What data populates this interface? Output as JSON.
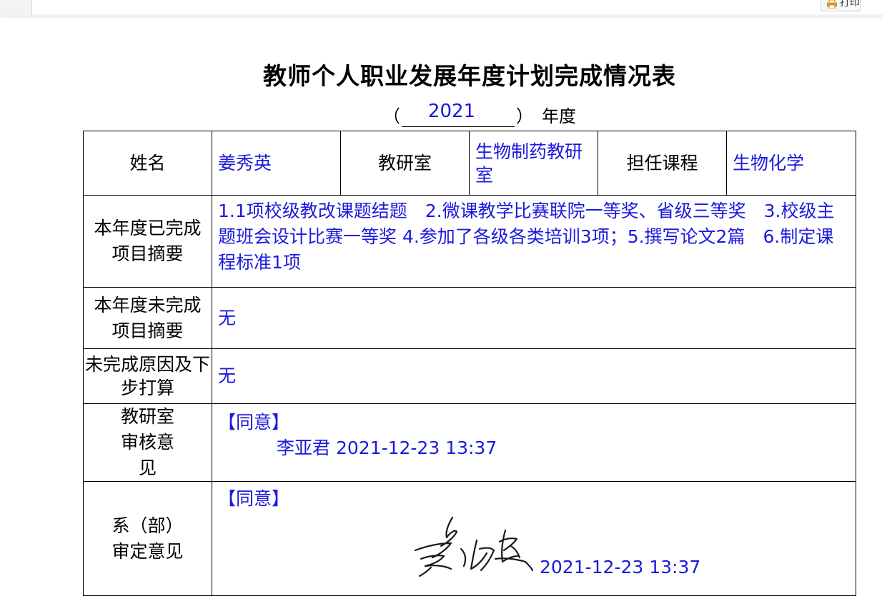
{
  "toolbar": {
    "print_label": "打印"
  },
  "form": {
    "title": "教师个人职业发展年度计划完成情况表",
    "year_open_paren": "（",
    "year_value": "2021",
    "year_close_paren": "）",
    "year_label": "年度",
    "name_label": "姓名",
    "name_value": "姜秀英",
    "dept_label": "教研室",
    "dept_value": "生物制药教研室",
    "course_label": "担任课程",
    "course_value": "生物化学",
    "completed_label": "本年度已完成项目摘要",
    "completed_value": "1.1项校级教改课题结题　2.微课教学比赛联院一等奖、省级三等奖　3.校级主题班会设计比赛一等奖 4.参加了各级各类培训3项；5.撰写论文2篇　6.制定课程标准1项",
    "uncompleted_label": "本年度未完成项目摘要",
    "uncompleted_value": "无",
    "reason_label": "未完成原因及下步打算",
    "reason_value": "无",
    "dept_review_label": "教研室审核意见",
    "dept_review_opinion": "【同意】",
    "dept_review_signer": "李亚君 2021-12-23 13:37",
    "faculty_review_label": "系（部）审定意见",
    "faculty_review_opinion": "【同意】",
    "faculty_review_date": "2021-12-23 13:37"
  },
  "colors": {
    "filled_text": "#1a1adc",
    "border": "#000000"
  },
  "icons": {
    "print": "printer-icon",
    "signature": "handwritten-signature"
  }
}
